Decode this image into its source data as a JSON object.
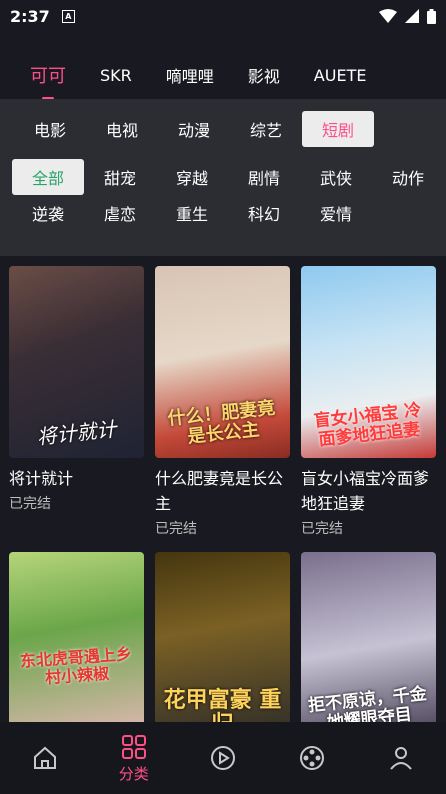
{
  "status_bar": {
    "time": "2:37",
    "app_badge": "A"
  },
  "source_tabs": [
    {
      "label": "可可",
      "active": true
    },
    {
      "label": "SKR"
    },
    {
      "label": "嘀哩哩"
    },
    {
      "label": "影视"
    },
    {
      "label": "AUETE"
    }
  ],
  "categories": [
    "电影",
    "电视",
    "动漫",
    "综艺",
    "短剧"
  ],
  "active_category": "短剧",
  "genres": [
    "全部",
    "甜宠",
    "穿越",
    "剧情",
    "武侠",
    "动作",
    "逆袭",
    "虐恋",
    "重生",
    "科幻",
    "爱情"
  ],
  "active_genre": "全部",
  "items": [
    {
      "title": "将计就计",
      "status": "已完结",
      "poster_text": "将计就计"
    },
    {
      "title": "什么肥妻竟是长公主",
      "status": "已完结",
      "poster_text": "什么！肥妻竟是长公主"
    },
    {
      "title": "盲女小福宝冷面爹地狂追妻",
      "status": "已完结",
      "poster_text": "盲女小福宝 冷面爹地狂追妻"
    },
    {
      "title": "",
      "status": "",
      "poster_text": "东北虎哥遇上乡村小辣椒"
    },
    {
      "title": "",
      "status": "",
      "poster_text": "花甲富豪 重归"
    },
    {
      "title": "",
      "status": "",
      "poster_text": "拒不原谅，千金她耀眼夺目"
    }
  ],
  "bottom_nav": [
    {
      "icon": "home-icon",
      "label": ""
    },
    {
      "icon": "category-grid-icon",
      "label": "分类",
      "active": true
    },
    {
      "icon": "play-circle-icon",
      "label": ""
    },
    {
      "icon": "film-reel-icon",
      "label": ""
    },
    {
      "icon": "user-icon",
      "label": ""
    }
  ],
  "colors": {
    "accent": "#ff4f87",
    "genre_active": "#2aa56a",
    "background": "#191a21",
    "panel": "#2b2d33"
  }
}
